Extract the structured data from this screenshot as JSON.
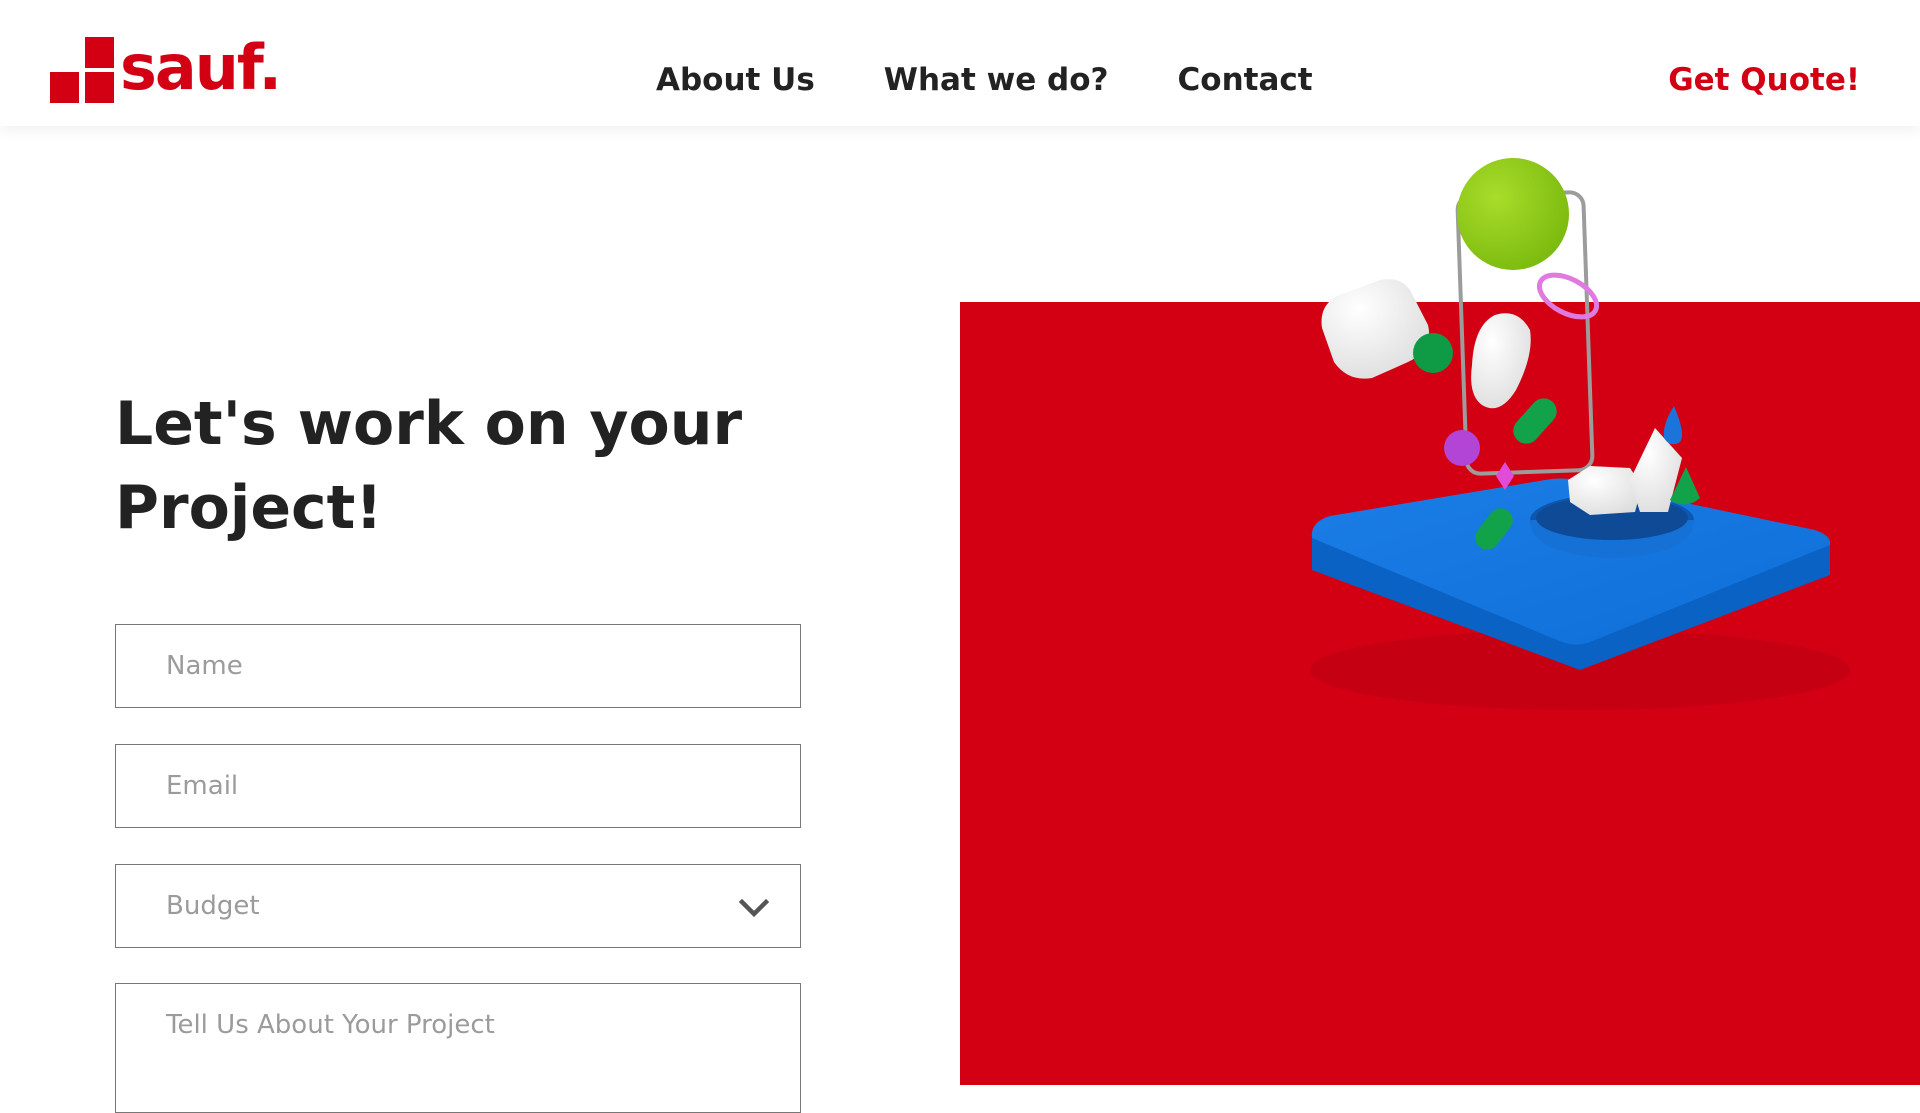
{
  "brand": {
    "name": "sauf.",
    "accent_color": "#d30014"
  },
  "nav": {
    "items": [
      {
        "label": "About Us"
      },
      {
        "label": "What we do?"
      },
      {
        "label": "Contact"
      }
    ],
    "cta_label": "Get Quote!"
  },
  "hero": {
    "title_line1": "Let's work on your",
    "title_line2": "Project!"
  },
  "form": {
    "name_placeholder": "Name",
    "email_placeholder": "Email",
    "budget_placeholder": "Budget",
    "project_placeholder": "Tell Us About Your Project"
  },
  "illustration": {
    "icon": "3d-phone-composition-illustration"
  }
}
